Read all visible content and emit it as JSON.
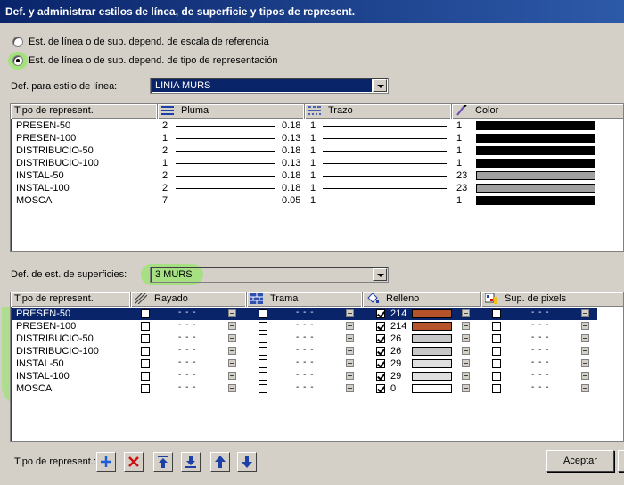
{
  "window": {
    "title": "Def. y administrar estilos de línea, de superficie y tipos de represent."
  },
  "mode_options": [
    {
      "label": "Est. de línea o de sup. depend. de escala de referencia",
      "checked": false
    },
    {
      "label": "Est. de línea o de sup. depend. de tipo de representación",
      "checked": true
    }
  ],
  "line_style": {
    "label": "Def. para estilo de línea:",
    "value": "LINIA MURS",
    "columns": [
      "Tipo de represent.",
      "Pluma",
      "Trazo",
      "Color"
    ],
    "rows": [
      {
        "name": "PRESEN-50",
        "pen": "2",
        "thick": "0.18",
        "trace": "1",
        "color_no": "1",
        "color": "#000000"
      },
      {
        "name": "PRESEN-100",
        "pen": "1",
        "thick": "0.13",
        "trace": "1",
        "color_no": "1",
        "color": "#000000"
      },
      {
        "name": "DISTRIBUCIO-50",
        "pen": "2",
        "thick": "0.18",
        "trace": "1",
        "color_no": "1",
        "color": "#000000"
      },
      {
        "name": "DISTRIBUCIO-100",
        "pen": "1",
        "thick": "0.13",
        "trace": "1",
        "color_no": "1",
        "color": "#000000"
      },
      {
        "name": "INSTAL-50",
        "pen": "2",
        "thick": "0.18",
        "trace": "1",
        "color_no": "23",
        "color": "#a0a0a0"
      },
      {
        "name": "INSTAL-100",
        "pen": "2",
        "thick": "0.18",
        "trace": "1",
        "color_no": "23",
        "color": "#a0a0a0"
      },
      {
        "name": "MOSCA",
        "pen": "7",
        "thick": "0.05",
        "trace": "1",
        "color_no": "1",
        "color": "#000000"
      }
    ]
  },
  "surface_style": {
    "label": "Def. de est. de superficies:",
    "value": "3 MURS",
    "columns": [
      "Tipo de represent.",
      "Rayado",
      "Trama",
      "Relleno",
      "Sup. de pixels"
    ],
    "dash": "- - -",
    "rows": [
      {
        "name": "PRESEN-50",
        "fill_no": "214",
        "fill_color": "#b5532a",
        "selected": true
      },
      {
        "name": "PRESEN-100",
        "fill_no": "214",
        "fill_color": "#b5532a",
        "selected": false
      },
      {
        "name": "DISTRIBUCIO-50",
        "fill_no": "26",
        "fill_color": "#c8c8c8",
        "selected": false
      },
      {
        "name": "DISTRIBUCIO-100",
        "fill_no": "26",
        "fill_color": "#c8c8c8",
        "selected": false
      },
      {
        "name": "INSTAL-50",
        "fill_no": "29",
        "fill_color": "#e0e0e0",
        "selected": false
      },
      {
        "name": "INSTAL-100",
        "fill_no": "29",
        "fill_color": "#e0e0e0",
        "selected": false
      },
      {
        "name": "MOSCA",
        "fill_no": "0",
        "fill_color": "#ffffff",
        "selected": false
      }
    ]
  },
  "toolbar": {
    "label": "Tipo de represent.:",
    "buttons": [
      {
        "icon": "plus-icon",
        "color": "#1c5fd6"
      },
      {
        "icon": "delete-x-icon",
        "color": "#d01010"
      },
      {
        "icon": "move-top-icon",
        "color": "#1c3fa8"
      },
      {
        "icon": "move-bottom-icon",
        "color": "#1c3fa8"
      },
      {
        "icon": "move-up-icon",
        "color": "#1c3fa8"
      },
      {
        "icon": "move-down-icon",
        "color": "#1c3fa8"
      }
    ]
  },
  "actions": {
    "accept_label": "Aceptar"
  }
}
